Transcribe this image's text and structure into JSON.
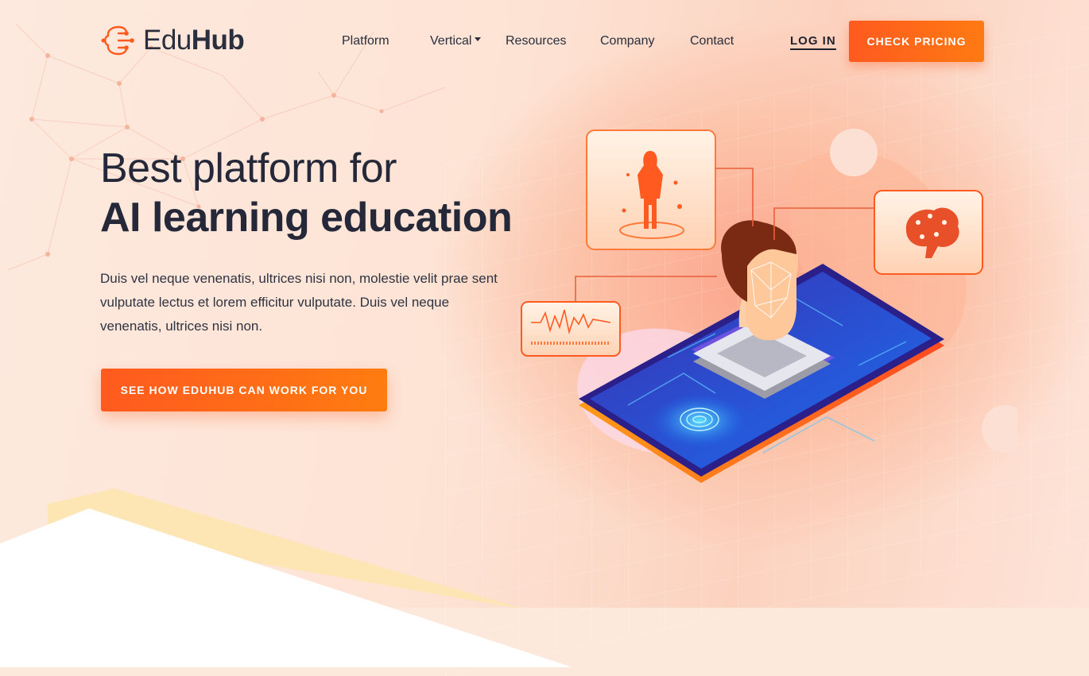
{
  "brand": {
    "name_light": "Edu",
    "name_bold": "Hub"
  },
  "nav": {
    "items": [
      "Platform",
      "Vertical",
      "Resources",
      "Company",
      "Contact"
    ],
    "login": "LOG IN",
    "pricing": "CHECK PRICING"
  },
  "hero": {
    "title_line1": "Best platform for",
    "title_line2": "AI learning education",
    "description": "Duis vel neque venenatis, ultrices nisi non, molestie velit prae sent vulputate lectus et lorem efficitur vulputate. Duis vel neque venenatis, ultrices nisi non.",
    "cta": "SEE HOW EDUHUB CAN WORK FOR YOU"
  },
  "colors": {
    "accent": "#ff5a1f",
    "accent2": "#ff7c10",
    "text": "#242838",
    "bg": "#fde8dc"
  },
  "icons": [
    "brain-circuit-logo-icon",
    "caret-down-icon",
    "ai-device-illustration"
  ]
}
